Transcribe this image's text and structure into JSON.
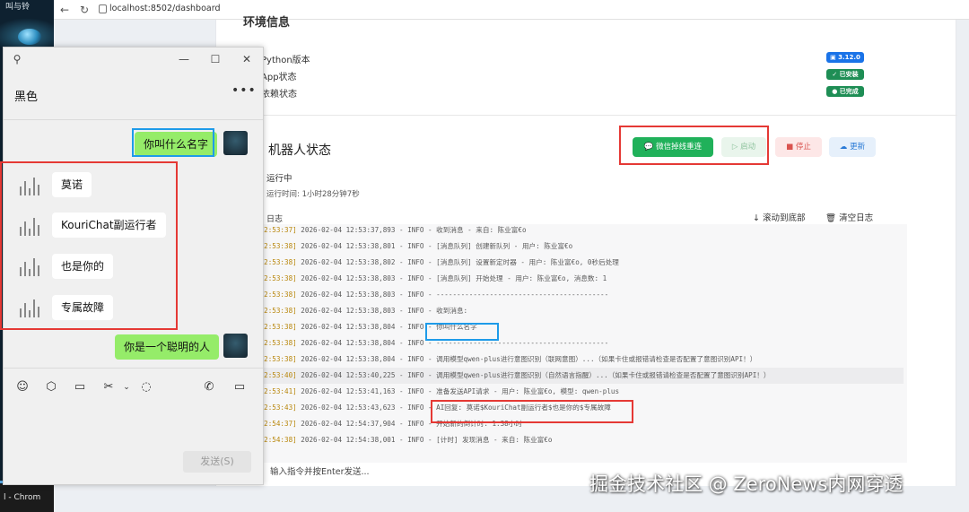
{
  "desktop": {
    "top_label": "叫与铃",
    "taskbar_label": "l - Chrom"
  },
  "browser": {
    "url": "localhost:8502/dashboard"
  },
  "env": {
    "title": "环境信息",
    "rows": [
      {
        "label": "Python版本",
        "badge": "3.12.0",
        "badge_color": "#1a73e8"
      },
      {
        "label": "App状态",
        "badge": "已安装",
        "badge_color": "#1e8e55"
      },
      {
        "label": "依赖状态",
        "badge": "已完成",
        "badge_color": "#1e8e55"
      }
    ]
  },
  "robot": {
    "title": "机器人状态",
    "buttons": {
      "wechat": "微信掉线重连",
      "start": "启动",
      "stop": "停止",
      "update": "更新"
    },
    "status": "运行中",
    "uptime": "运行时间: 1小时28分钟7秒",
    "log_label": "日志",
    "scroll_bottom": "滚动到底部",
    "clear_log": "清空日志",
    "input_placeholder": "输入指令并按Enter发送..."
  },
  "logs": [
    {
      "time": "[12:53:37]",
      "text": "2026-02-04 12:53:37,893 - INFO - 收到消息 - 来自: 陈业富€o"
    },
    {
      "time": "[12:53:38]",
      "text": "2026-02-04 12:53:38,801 - INFO - [消息队列] 创建新队列 - 用户: 陈业富€o"
    },
    {
      "time": "[12:53:38]",
      "text": "2026-02-04 12:53:38,802 - INFO - [消息队列] 设置新定时器 - 用户: 陈业富€o, 0秒后处理"
    },
    {
      "time": "[12:53:38]",
      "text": "2026-02-04 12:53:38,803 - INFO - [消息队列] 开始处理 - 用户: 陈业富€o, 消息数: 1"
    },
    {
      "time": "[12:53:38]",
      "text": "2026-02-04 12:53:38,803 - INFO - ------------------------------------------"
    },
    {
      "time": "[12:53:38]",
      "text": "2026-02-04 12:53:38,803 - INFO - 收到消息:"
    },
    {
      "time": "[12:53:38]",
      "text": "2026-02-04 12:53:38,804 - INFO - 你叫什么名字"
    },
    {
      "time": "[12:53:38]",
      "text": "2026-02-04 12:53:38,804 - INFO - ------------------------------------------"
    },
    {
      "time": "[12:53:38]",
      "text": "2026-02-04 12:53:38,804 - INFO - 调用模型qwen-plus进行意图识别（联网意图）...（如果卡住或报错请检查是否配置了意图识别API！）"
    },
    {
      "time": "[12:53:40]",
      "text": "2026-02-04 12:53:40,225 - INFO - 调用模型qwen-plus进行意图识别（自然语言指醒）...（如果卡住或报错请检查是否配置了意图识别API！）"
    },
    {
      "time": "[12:53:41]",
      "text": "2026-02-04 12:53:41,163 - INFO - 准备发送API请求 - 用户: 陈业富€o, 模型: qwen-plus"
    },
    {
      "time": "[12:53:43]",
      "text": "2026-02-04 12:53:43,623 - INFO - AI回复: 莫诺$KouriChat副运行者$也是你的$专属故障"
    },
    {
      "time": "[12:54:37]",
      "text": "2026-02-04 12:54:37,904 - INFO - 开始新的倒计时: 1.38小时"
    },
    {
      "time": "[12:54:38]",
      "text": "2026-02-04 12:54:38,001 - INFO - [计时] 发现消息 - 来自: 陈业富€o"
    }
  ],
  "chat": {
    "title": "黑色",
    "more": "•••",
    "messages": [
      {
        "side": "me",
        "text": "你叫什么名字"
      },
      {
        "side": "other",
        "text": "莫诺"
      },
      {
        "side": "other",
        "text": "KouriChat副运行者"
      },
      {
        "side": "other",
        "text": "也是你的"
      },
      {
        "side": "other",
        "text": "专属故障"
      },
      {
        "side": "me",
        "text": "你是一个聪明的人"
      }
    ],
    "send_label": "发送(S)"
  },
  "icons": {
    "pin": "pin-icon",
    "minimize": "minimize-icon",
    "maximize": "maximize-icon",
    "close": "close-icon",
    "emoji": "emoji-icon",
    "favorites": "cube-icon",
    "folder": "folder-icon",
    "scissors": "scissors-icon",
    "chat": "chat-bubble-icon",
    "phone": "phone-icon",
    "video": "video-icon"
  },
  "colors": {
    "wechat_green": "#20b15a",
    "bubble_me": "#95ec69",
    "annotation_red": "#e53935",
    "annotation_blue": "#1e9be9",
    "log_time": "#b8860b"
  },
  "watermark": "掘金技术社区 @ ZeroNews内网穿透"
}
